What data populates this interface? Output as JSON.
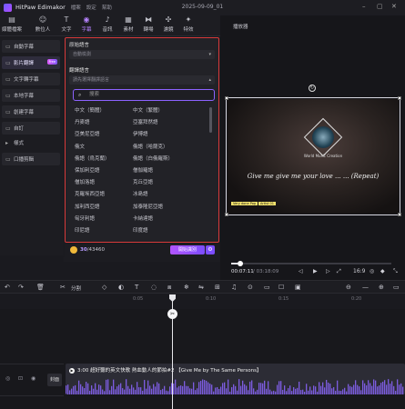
{
  "app": {
    "name": "HitPaw Edimakor",
    "menu": [
      "檔案",
      "設定",
      "幫助"
    ],
    "project": "2025-09-09_01"
  },
  "toolbar": {
    "items": [
      {
        "label": "媒體檔案",
        "icon": "folder-icon"
      },
      {
        "label": "數位人",
        "icon": "avatar-icon"
      },
      {
        "label": "文字",
        "icon": "text-icon"
      },
      {
        "label": "字幕",
        "icon": "subtitle-icon",
        "active": true
      },
      {
        "label": "音訊",
        "icon": "music-icon"
      },
      {
        "label": "素材",
        "icon": "sticker-icon"
      },
      {
        "label": "轉場",
        "icon": "transition-icon"
      },
      {
        "label": "濾鏡",
        "icon": "filter-icon"
      },
      {
        "label": "特效",
        "icon": "effects-icon"
      }
    ]
  },
  "sidebar": {
    "items": [
      {
        "label": "自動字幕",
        "icon": "auto-subtitle-icon"
      },
      {
        "label": "影片翻譯",
        "icon": "translate-icon",
        "active": true,
        "badge": "Free"
      },
      {
        "label": "文字轉字幕",
        "icon": "text-subtitle-icon"
      },
      {
        "label": "本地字幕",
        "icon": "local-file-icon"
      },
      {
        "label": "創建字幕",
        "icon": "create-icon"
      },
      {
        "label": "自訂",
        "icon": "custom-icon"
      },
      {
        "label": "樣式",
        "icon": "chevron-right-icon"
      },
      {
        "label": "口播剪輯",
        "icon": "voice-cut-icon"
      }
    ]
  },
  "panel": {
    "source_label": "原始語言",
    "source_value": "自動檢測",
    "target_label": "翻譯語言",
    "target_placeholder": "請先選擇翻譯語言",
    "search_placeholder": "搜索",
    "languages": [
      [
        "中文（簡體）",
        "中文（繁體）"
      ],
      [
        "丹麥語",
        "亞塞拜然語"
      ],
      [
        "亞美尼亞語",
        "伊博語"
      ],
      [
        "俄文",
        "俄語（哈薩克）"
      ],
      [
        "俄語（烏克蘭）",
        "俄語（白俄羅斯）"
      ],
      [
        "保加利亞語",
        "僧伽羅語"
      ],
      [
        "僧加洛語",
        "克丘亞語"
      ],
      [
        "克羅埃西亞語",
        "冰島語"
      ],
      [
        "加利西亞語",
        "加泰隆尼亞語"
      ],
      [
        "匈牙利語",
        "卡納達語"
      ],
      [
        "印尼語",
        "印度語"
      ]
    ]
  },
  "credits": {
    "used": "30",
    "total": "/43460"
  },
  "identify_button": "開始識別",
  "preview": {
    "title": "播放器",
    "lyric": "Give me give me your love ... ... (Repeat)",
    "album_text": "World Music Creation",
    "tag1": "Very done Pop",
    "tag2": "Artist 01",
    "current_time": "00:07:11",
    "total_time": "/ 03:18:09",
    "ratio": "16:9",
    "progress": 0.04
  },
  "timeline": {
    "split_label": "分割",
    "ticks": [
      "0:05",
      "0:10",
      "0:15",
      "0:20"
    ],
    "cover_label": "封面",
    "clip_title": "3:00 超好聽的英文快歌 熱血動人的節拍#2 【Give Me by The Same Persons】"
  },
  "colors": {
    "accent": "#b783ff",
    "highlight_border": "#d83a3a",
    "waveform": "#7c5ce0"
  }
}
